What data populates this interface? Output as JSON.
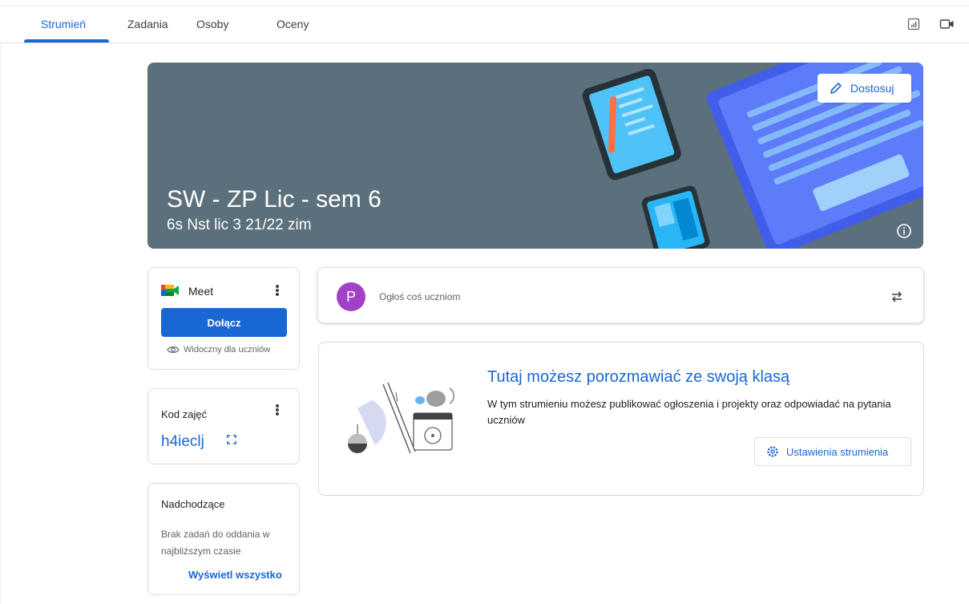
{
  "tabs": [
    {
      "label": "Strumień",
      "active": true
    },
    {
      "label": "Zadania",
      "active": false
    },
    {
      "label": "Osoby",
      "active": false
    },
    {
      "label": "Oceny",
      "active": false
    }
  ],
  "top_icons": [
    "grades-table-icon",
    "video-call-icon"
  ],
  "banner": {
    "title": "SW - ZP Lic - sem 6",
    "subtitle": "6s Nst lic 3 21/22 zim",
    "customize_label": "Dostosuj",
    "background_color": "#5c6f7c"
  },
  "meet": {
    "label": "Meet",
    "join_label": "Dołącz",
    "visibility_label": "Widoczny dla uczniów"
  },
  "class_code": {
    "label": "Kod zajęć",
    "value": "h4ieclj"
  },
  "upcoming": {
    "title": "Nadchodzące",
    "empty_text": "Brak zadań do oddania w najbliższym czasie",
    "view_all_label": "Wyświetl wszystko"
  },
  "announce": {
    "avatar_letter": "P",
    "placeholder": "Ogłoś coś uczniom",
    "avatar_color": "#a142c6"
  },
  "stream_info": {
    "title": "Tutaj możesz porozmawiać ze swoją klasą",
    "text": "W tym strumieniu możesz publikować ogłoszenia i projekty oraz odpowiadać na pytania uczniów",
    "settings_label": "Ustawienia strumienia"
  },
  "accent_color": "#1967d2"
}
